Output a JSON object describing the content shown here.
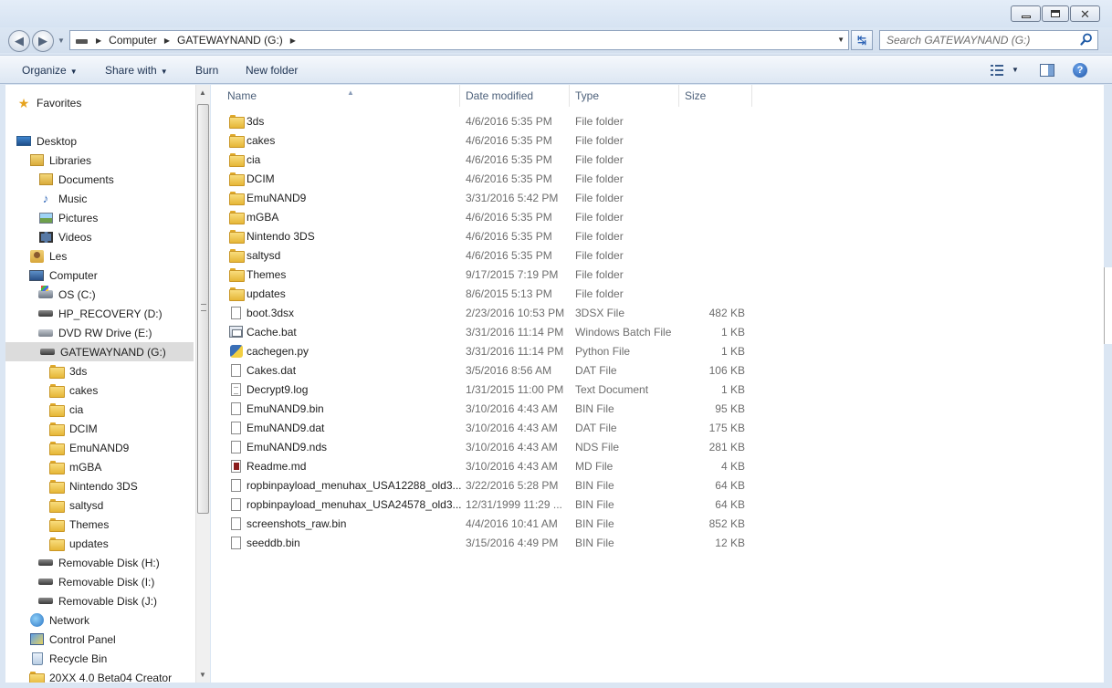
{
  "window": {
    "minimize_glyph": "",
    "close_glyph": "✕"
  },
  "address": {
    "crumbs": [
      "Computer",
      "GATEWAYNAND (G:)"
    ]
  },
  "search": {
    "placeholder": "Search GATEWAYNAND (G:)"
  },
  "toolbar": {
    "organize": "Organize",
    "share_with": "Share with",
    "burn": "Burn",
    "new_folder": "New folder",
    "help": "?"
  },
  "navigation": {
    "items": [
      {
        "label": "Favorites",
        "icon": "star-icon",
        "level": 0
      },
      {
        "label": "Desktop",
        "icon": "desktop-icon",
        "level": 0
      },
      {
        "label": "Libraries",
        "icon": "libraries-icon",
        "level": 1
      },
      {
        "label": "Documents",
        "icon": "documents-icon",
        "level": 2
      },
      {
        "label": "Music",
        "icon": "music-icon",
        "level": 2
      },
      {
        "label": "Pictures",
        "icon": "pictures-icon",
        "level": 2
      },
      {
        "label": "Videos",
        "icon": "videos-icon",
        "level": 2
      },
      {
        "label": "Les",
        "icon": "user-folder-icon",
        "level": 1
      },
      {
        "label": "Computer",
        "icon": "computer-icon",
        "level": 1
      },
      {
        "label": "OS (C:)",
        "icon": "os-drive-icon",
        "level": 2
      },
      {
        "label": "HP_RECOVERY (D:)",
        "icon": "drive-icon",
        "level": 2
      },
      {
        "label": "DVD RW Drive (E:)",
        "icon": "dvd-drive-icon",
        "level": 2
      },
      {
        "label": "GATEWAYNAND (G:)",
        "icon": "drive-icon",
        "level": 2,
        "selected": true
      },
      {
        "label": "3ds",
        "icon": "folder-icon",
        "level": 3
      },
      {
        "label": "cakes",
        "icon": "folder-icon",
        "level": 3
      },
      {
        "label": "cia",
        "icon": "folder-icon",
        "level": 3
      },
      {
        "label": "DCIM",
        "icon": "folder-icon",
        "level": 3
      },
      {
        "label": "EmuNAND9",
        "icon": "folder-icon",
        "level": 3
      },
      {
        "label": "mGBA",
        "icon": "folder-icon",
        "level": 3
      },
      {
        "label": "Nintendo 3DS",
        "icon": "folder-icon",
        "level": 3
      },
      {
        "label": "saltysd",
        "icon": "folder-icon",
        "level": 3
      },
      {
        "label": "Themes",
        "icon": "folder-icon",
        "level": 3
      },
      {
        "label": "updates",
        "icon": "folder-icon",
        "level": 3
      },
      {
        "label": "Removable Disk (H:)",
        "icon": "drive-icon",
        "level": 2
      },
      {
        "label": "Removable Disk (I:)",
        "icon": "drive-icon",
        "level": 2
      },
      {
        "label": "Removable Disk (J:)",
        "icon": "drive-icon",
        "level": 2
      },
      {
        "label": "Network",
        "icon": "network-icon",
        "level": 1
      },
      {
        "label": "Control Panel",
        "icon": "control-panel-icon",
        "level": 1
      },
      {
        "label": "Recycle Bin",
        "icon": "recycle-bin-icon",
        "level": 1
      },
      {
        "label": "20XX 4.0 Beta04 Creator",
        "icon": "folder-icon",
        "level": 1
      }
    ]
  },
  "columns": {
    "name": "Name",
    "date": "Date modified",
    "type": "Type",
    "size": "Size"
  },
  "files": [
    {
      "name": "3ds",
      "date": "4/6/2016 5:35 PM",
      "type": "File folder",
      "size": "",
      "icon": "folder"
    },
    {
      "name": "cakes",
      "date": "4/6/2016 5:35 PM",
      "type": "File folder",
      "size": "",
      "icon": "folder"
    },
    {
      "name": "cia",
      "date": "4/6/2016 5:35 PM",
      "type": "File folder",
      "size": "",
      "icon": "folder"
    },
    {
      "name": "DCIM",
      "date": "4/6/2016 5:35 PM",
      "type": "File folder",
      "size": "",
      "icon": "folder"
    },
    {
      "name": "EmuNAND9",
      "date": "3/31/2016 5:42 PM",
      "type": "File folder",
      "size": "",
      "icon": "folder"
    },
    {
      "name": "mGBA",
      "date": "4/6/2016 5:35 PM",
      "type": "File folder",
      "size": "",
      "icon": "folder"
    },
    {
      "name": "Nintendo 3DS",
      "date": "4/6/2016 5:35 PM",
      "type": "File folder",
      "size": "",
      "icon": "folder"
    },
    {
      "name": "saltysd",
      "date": "4/6/2016 5:35 PM",
      "type": "File folder",
      "size": "",
      "icon": "folder"
    },
    {
      "name": "Themes",
      "date": "9/17/2015 7:19 PM",
      "type": "File folder",
      "size": "",
      "icon": "folder"
    },
    {
      "name": "updates",
      "date": "8/6/2015 5:13 PM",
      "type": "File folder",
      "size": "",
      "icon": "folder"
    },
    {
      "name": "boot.3dsx",
      "date": "2/23/2016 10:53 PM",
      "type": "3DSX File",
      "size": "482 KB",
      "icon": "doc"
    },
    {
      "name": "Cache.bat",
      "date": "3/31/2016 11:14 PM",
      "type": "Windows Batch File",
      "size": "1 KB",
      "icon": "bat"
    },
    {
      "name": "cachegen.py",
      "date": "3/31/2016 11:14 PM",
      "type": "Python File",
      "size": "1 KB",
      "icon": "py"
    },
    {
      "name": "Cakes.dat",
      "date": "3/5/2016 8:56 AM",
      "type": "DAT File",
      "size": "106 KB",
      "icon": "doc"
    },
    {
      "name": "Decrypt9.log",
      "date": "1/31/2015 11:00 PM",
      "type": "Text Document",
      "size": "1 KB",
      "icon": "txt"
    },
    {
      "name": "EmuNAND9.bin",
      "date": "3/10/2016 4:43 AM",
      "type": "BIN File",
      "size": "95 KB",
      "icon": "doc"
    },
    {
      "name": "EmuNAND9.dat",
      "date": "3/10/2016 4:43 AM",
      "type": "DAT File",
      "size": "175 KB",
      "icon": "doc"
    },
    {
      "name": "EmuNAND9.nds",
      "date": "3/10/2016 4:43 AM",
      "type": "NDS File",
      "size": "281 KB",
      "icon": "doc"
    },
    {
      "name": "Readme.md",
      "date": "3/10/2016 4:43 AM",
      "type": "MD File",
      "size": "4 KB",
      "icon": "md"
    },
    {
      "name": "ropbinpayload_menuhax_USA12288_old3...",
      "date": "3/22/2016 5:28 PM",
      "type": "BIN File",
      "size": "64 KB",
      "icon": "doc"
    },
    {
      "name": "ropbinpayload_menuhax_USA24578_old3...",
      "date": "12/31/1999 11:29 ...",
      "type": "BIN File",
      "size": "64 KB",
      "icon": "doc"
    },
    {
      "name": "screenshots_raw.bin",
      "date": "4/4/2016 10:41 AM",
      "type": "BIN File",
      "size": "852 KB",
      "icon": "doc"
    },
    {
      "name": "seeddb.bin",
      "date": "3/15/2016 4:49 PM",
      "type": "BIN File",
      "size": "12 KB",
      "icon": "doc"
    }
  ]
}
